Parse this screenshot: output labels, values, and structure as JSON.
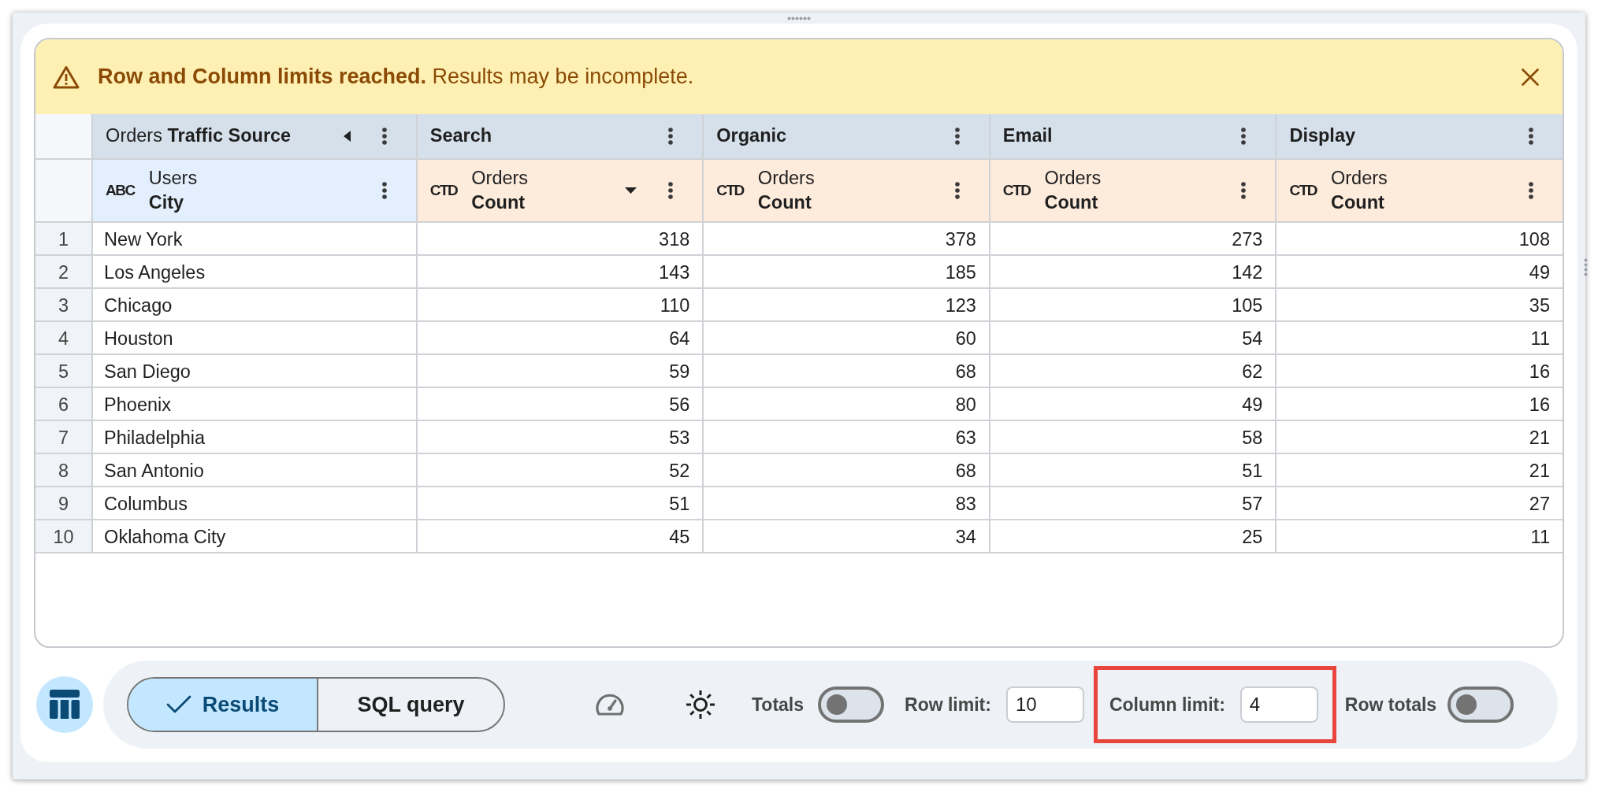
{
  "banner": {
    "message": "**Row and Column limits reached.** Results may be incomplete."
  },
  "table": {
    "pivot_header": {
      "view": "Orders",
      "field": "Traffic Source"
    },
    "pivot_values": [
      "Search",
      "Organic",
      "Email",
      "Display"
    ],
    "columns": [
      {
        "kind": "dimension",
        "type_label": "ABC",
        "view": "Users",
        "field": "City",
        "sorted_descending": false
      },
      {
        "kind": "measure",
        "type_label": "CTD",
        "view": "Orders",
        "field": "Count",
        "sorted_descending": true
      },
      {
        "kind": "measure",
        "type_label": "CTD",
        "view": "Orders",
        "field": "Count",
        "sorted_descending": false
      },
      {
        "kind": "measure",
        "type_label": "CTD",
        "view": "Orders",
        "field": "Count",
        "sorted_descending": false
      },
      {
        "kind": "measure",
        "type_label": "CTD",
        "view": "Orders",
        "field": "Count",
        "sorted_descending": false
      }
    ],
    "rows": [
      {
        "number": "1",
        "cells": [
          "New York",
          "318",
          "378",
          "273",
          "108"
        ]
      },
      {
        "number": "2",
        "cells": [
          "Los Angeles",
          "143",
          "185",
          "142",
          "49"
        ]
      },
      {
        "number": "3",
        "cells": [
          "Chicago",
          "110",
          "123",
          "105",
          "35"
        ]
      },
      {
        "number": "4",
        "cells": [
          "Houston",
          "64",
          "60",
          "54",
          "11"
        ]
      },
      {
        "number": "5",
        "cells": [
          "San Diego",
          "59",
          "68",
          "62",
          "16"
        ]
      },
      {
        "number": "6",
        "cells": [
          "Phoenix",
          "56",
          "80",
          "49",
          "16"
        ]
      },
      {
        "number": "7",
        "cells": [
          "Philadelphia",
          "53",
          "63",
          "58",
          "21"
        ]
      },
      {
        "number": "8",
        "cells": [
          "San Antonio",
          "52",
          "68",
          "51",
          "21"
        ]
      },
      {
        "number": "9",
        "cells": [
          "Columbus",
          "51",
          "83",
          "57",
          "27"
        ]
      },
      {
        "number": "10",
        "cells": [
          "Oklahoma City",
          "45",
          "34",
          "25",
          "11"
        ]
      }
    ]
  },
  "toolbar": {
    "tabs": [
      {
        "label": "Results",
        "selected": true
      },
      {
        "label": "SQL query",
        "selected": false
      }
    ],
    "totals": {
      "label": "Totals",
      "on": false
    },
    "row_limit": {
      "label": "Row limit:",
      "value": "10"
    },
    "column_limit": {
      "label": "Column limit:",
      "value": "4",
      "highlighted": true
    },
    "row_totals": {
      "label": "Row totals",
      "on": false
    }
  }
}
